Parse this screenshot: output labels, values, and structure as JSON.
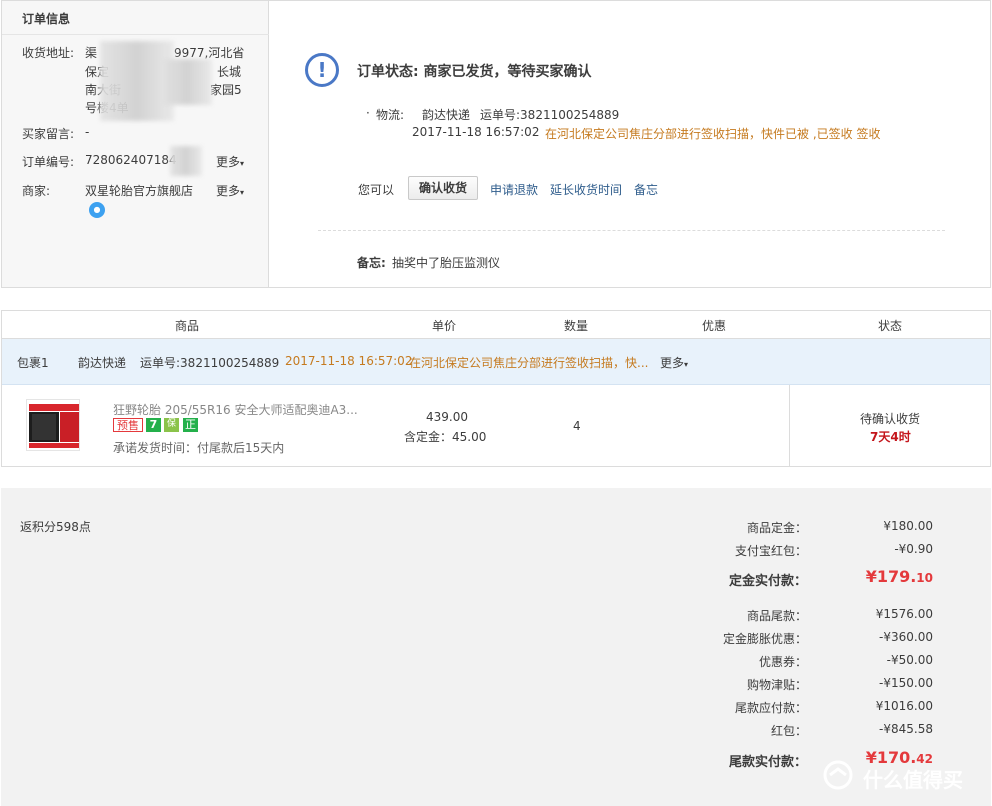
{
  "order_info": {
    "title": "订单信息",
    "address_label": "收货地址:",
    "address_lines": [
      "渠",
      "9977,河北省",
      "保定",
      "长城",
      "南大街",
      "家园5",
      "号楼4单"
    ],
    "message_label": "买家留言:",
    "message_value": "-",
    "order_no_label": "订单编号:",
    "order_no_value": "728062407184",
    "more_label": "更多",
    "seller_label": "商家:",
    "seller_value": "双星轮胎官方旗舰店"
  },
  "status": {
    "title": "订单状态: 商家已发货，等待买家确认",
    "logistics_label": "物流:",
    "carrier": "韵达快递",
    "tracking": "运单号:3821100254889",
    "time": "2017-11-18 16:57:02",
    "message": "在河北保定公司焦庄分部进行签收扫描，快件已被 ,已签收 签收",
    "you_can": "您可以",
    "actions": {
      "confirm": "确认收货",
      "refund": "申请退款",
      "extend": "延长收货时间",
      "note": "备忘"
    },
    "memo_label": "备忘:",
    "memo_value": "抽奖中了胎压监测仪"
  },
  "table": {
    "headers": [
      "商品",
      "单价",
      "数量",
      "优惠",
      "状态"
    ],
    "package": {
      "label": "包裹1",
      "carrier": "韵达快递",
      "tracking": "运单号:3821100254889",
      "time": "2017-11-18 16:57:02",
      "message": "在河北保定公司焦庄分部进行签收扫描，快...",
      "more": "更多"
    },
    "product": {
      "name": "狂野轮胎 205/55R16 安全大师适配奥迪A3...",
      "tags": [
        "预售",
        "7",
        "保",
        "正"
      ],
      "ship_time": "承诺发货时间：付尾款后15天内",
      "price": "439.00",
      "deposit": "含定金：45.00",
      "quantity": "4",
      "status": "待确认收货",
      "countdown": "7天4时"
    }
  },
  "summary": {
    "points": "返积分598点",
    "rows": [
      {
        "label": "商品定金：",
        "value": "¥180.00"
      },
      {
        "label": "支付宝红包：",
        "value": "-¥0.90"
      },
      {
        "label": "定金实付款：",
        "value_int": "¥179.",
        "value_dec": "10"
      },
      {
        "label": "商品尾款：",
        "value": "¥1576.00"
      },
      {
        "label": "定金膨胀优惠：",
        "value": "-¥360.00"
      },
      {
        "label": "优惠券：",
        "value": "-¥50.00"
      },
      {
        "label": "购物津贴：",
        "value": "-¥150.00"
      },
      {
        "label": "尾款应付款：",
        "value": "¥1016.00"
      },
      {
        "label": "红包：",
        "value": "-¥845.58"
      },
      {
        "label": "尾款实付款：",
        "value_int": "¥170.",
        "value_dec": "42"
      }
    ]
  },
  "watermark": "什么值得买"
}
